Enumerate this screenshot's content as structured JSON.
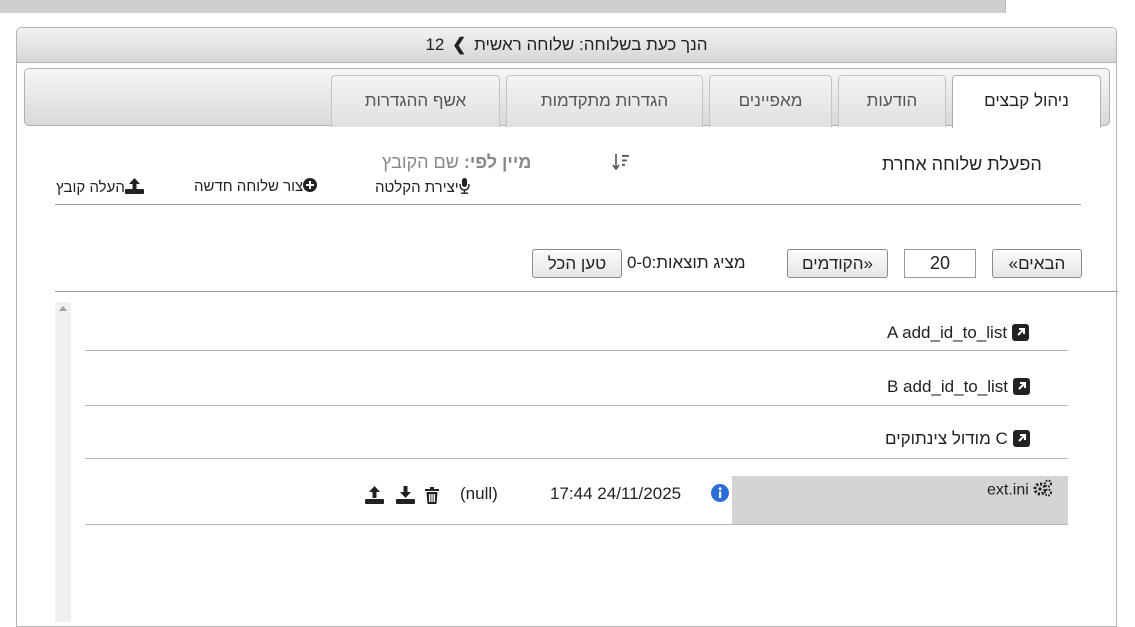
{
  "header": {
    "prefix": "הנך כעת בשלוחה:",
    "branch": "שלוחה ראשית",
    "chevron": "❯",
    "number": "12"
  },
  "tabs": [
    {
      "label": "ניהול קבצים",
      "active": true
    },
    {
      "label": "הודעות",
      "active": false
    },
    {
      "label": "מאפיינים",
      "active": false
    },
    {
      "label": "הגדרות מתקדמות",
      "active": false
    },
    {
      "label": "אשף ההגדרות",
      "active": false
    }
  ],
  "toolbar": {
    "activate_other": "הפעלת שלוחה אחרת",
    "sort_label": "מיין לפי",
    "sort_sep": ":",
    "sort_value": "שם הקובץ",
    "record_label": "יצירת הקלטה",
    "new_branch_label": "צור שלוחה חדשה",
    "upload_label": "העלה קובץ"
  },
  "pagination": {
    "next": "«הבאים",
    "page_size": "20",
    "prev": "הקודמים»",
    "results_text": "מציג תוצאות:0-0",
    "load_all": "טען הכל"
  },
  "entries": [
    {
      "type": "link",
      "label": "A add_id_to_list"
    },
    {
      "type": "link",
      "label": "B add_id_to_list"
    },
    {
      "type": "link",
      "label": "C מודול צינתוקים"
    }
  ],
  "file": {
    "name": "ext.ini",
    "date": "24/11/2025",
    "time": "17:44",
    "value": "(null)"
  },
  "colors": {
    "link_icon": "#222222",
    "info_icon": "#2b6fd6",
    "file_bg": "#d4d4d4"
  }
}
